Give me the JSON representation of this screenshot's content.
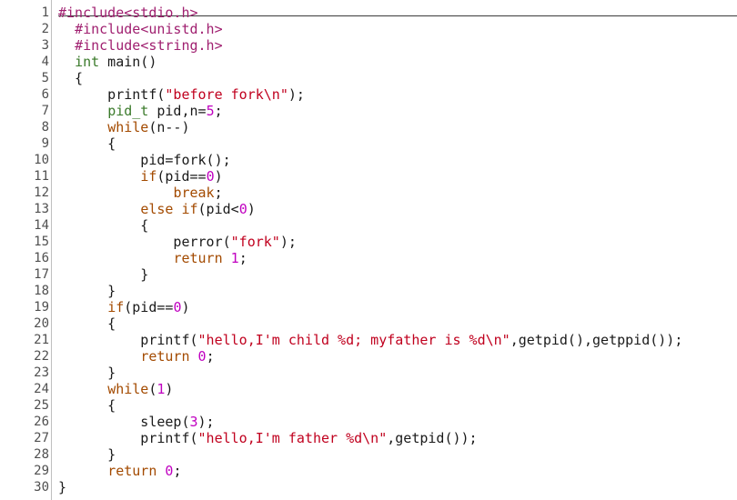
{
  "editor": {
    "lines": [
      {
        "num": "1",
        "code": "#include<stdio.h>",
        "kind": "pp"
      },
      {
        "num": "2",
        "code": "  #include<unistd.h>",
        "kind": "pp"
      },
      {
        "num": "3",
        "code": "  #include<string.h>",
        "kind": "pp"
      },
      {
        "num": "4",
        "code": "  int main()",
        "kind": "plain"
      },
      {
        "num": "5",
        "code": "  {",
        "kind": "plain"
      },
      {
        "num": "6",
        "code": "      printf(\"before fork\\n\");",
        "kind": "plain"
      },
      {
        "num": "7",
        "code": "      pid_t pid,n=5;",
        "kind": "plain"
      },
      {
        "num": "8",
        "code": "      while(n--)",
        "kind": "plain"
      },
      {
        "num": "9",
        "code": "      {",
        "kind": "plain"
      },
      {
        "num": "10",
        "code": "          pid=fork();",
        "kind": "plain"
      },
      {
        "num": "11",
        "code": "          if(pid==0)",
        "kind": "plain"
      },
      {
        "num": "12",
        "code": "              break;",
        "kind": "plain"
      },
      {
        "num": "13",
        "code": "          else if(pid<0)",
        "kind": "plain"
      },
      {
        "num": "14",
        "code": "          {",
        "kind": "plain"
      },
      {
        "num": "15",
        "code": "              perror(\"fork\");",
        "kind": "plain"
      },
      {
        "num": "16",
        "code": "              return 1;",
        "kind": "plain"
      },
      {
        "num": "17",
        "code": "          }",
        "kind": "plain"
      },
      {
        "num": "18",
        "code": "      }",
        "kind": "plain"
      },
      {
        "num": "19",
        "code": "      if(pid==0)",
        "kind": "plain"
      },
      {
        "num": "20",
        "code": "      {",
        "kind": "plain"
      },
      {
        "num": "21",
        "code": "          printf(\"hello,I'm child %d; myfather is %d\\n\",getpid(),getppid());",
        "kind": "plain"
      },
      {
        "num": "22",
        "code": "          return 0;",
        "kind": "plain"
      },
      {
        "num": "23",
        "code": "      }",
        "kind": "plain"
      },
      {
        "num": "24",
        "code": "      while(1)",
        "kind": "plain"
      },
      {
        "num": "25",
        "code": "      {",
        "kind": "plain"
      },
      {
        "num": "26",
        "code": "          sleep(3);",
        "kind": "plain"
      },
      {
        "num": "27",
        "code": "          printf(\"hello,I'm father %d\\n\",getpid());",
        "kind": "plain"
      },
      {
        "num": "28",
        "code": "      }",
        "kind": "plain"
      },
      {
        "num": "29",
        "code": "      return 0;",
        "kind": "plain"
      },
      {
        "num": "30",
        "code": "}",
        "kind": "plain"
      }
    ]
  },
  "colors": {
    "keyword": "#a34a00",
    "type": "#3a7a2a",
    "preprocessor": "#a02070",
    "string": "#c0001e",
    "number": "#c000c0",
    "line_number": "#505050"
  }
}
